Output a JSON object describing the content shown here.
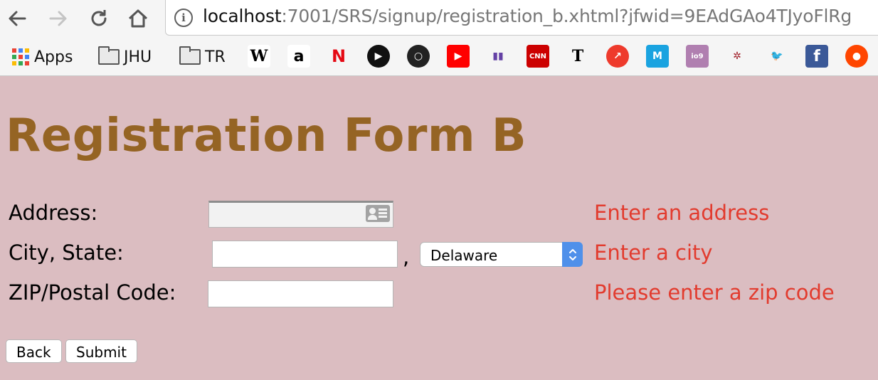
{
  "browser": {
    "url_host": "localhost",
    "url_rest": ":7001/SRS/signup/registration_b.xhtml?jfwid=9EAdGAo4TJyoFlRg",
    "bookmarks": [
      {
        "label": "Apps",
        "icon": "apps-grid-icon"
      },
      {
        "label": "JHU",
        "icon": "folder-icon"
      },
      {
        "label": "TR",
        "icon": "folder-icon"
      }
    ],
    "favicons": [
      {
        "name": "wikipedia-icon",
        "glyph": "W",
        "bg": "#ffffff",
        "fg": "#000000"
      },
      {
        "name": "amazon-icon",
        "glyph": "a",
        "bg": "#ffffff",
        "fg": "#000000"
      },
      {
        "name": "netflix-icon",
        "glyph": "N",
        "bg": "#f5f5f5",
        "fg": "#e50914"
      },
      {
        "name": "play-circle-icon",
        "glyph": "▶",
        "bg": "#111111",
        "fg": "#ffffff"
      },
      {
        "name": "record-circle-icon",
        "glyph": "○",
        "bg": "#222222",
        "fg": "#ffffff"
      },
      {
        "name": "youtube-icon",
        "glyph": "▶",
        "bg": "#ff0000",
        "fg": "#ffffff"
      },
      {
        "name": "twitch-icon",
        "glyph": "▮▮",
        "bg": "#f5f5f5",
        "fg": "#6441a5"
      },
      {
        "name": "cnn-icon",
        "glyph": "CNN",
        "bg": "#cc0000",
        "fg": "#ffffff"
      },
      {
        "name": "nytimes-icon",
        "glyph": "T",
        "bg": "#f5f5f5",
        "fg": "#000000"
      },
      {
        "name": "trending-icon",
        "glyph": "↗",
        "bg": "#ee3a2c",
        "fg": "#ffffff"
      },
      {
        "name": "medium-icon",
        "glyph": "M",
        "bg": "#1aa3e0",
        "fg": "#ffffff"
      },
      {
        "name": "io9-icon",
        "glyph": "io9",
        "bg": "#b07fb0",
        "fg": "#ffffff"
      },
      {
        "name": "bug-icon",
        "glyph": "✲",
        "bg": "#f5f5f5",
        "fg": "#a0202a"
      },
      {
        "name": "twitter-icon",
        "glyph": "🐦",
        "bg": "#f5f5f5",
        "fg": "#1da1f2"
      },
      {
        "name": "facebook-icon",
        "glyph": "f",
        "bg": "#3b5998",
        "fg": "#ffffff"
      },
      {
        "name": "reddit-icon",
        "glyph": "●",
        "bg": "#ff4500",
        "fg": "#ffffff"
      }
    ]
  },
  "page": {
    "title": "Registration Form B",
    "background": "#dbbdc1",
    "title_color": "#956424",
    "error_color": "#e23b2e"
  },
  "form": {
    "address_label": "Address:",
    "address_value": "",
    "address_error": "Enter an address",
    "city_state_label": "City, State:",
    "city_value": "",
    "comma": ",",
    "state_selected": "Delaware",
    "city_error": "Enter a city",
    "zip_label": "ZIP/Postal Code:",
    "zip_value": "",
    "zip_error": "Please enter a zip code",
    "back_label": "Back",
    "submit_label": "Submit"
  }
}
